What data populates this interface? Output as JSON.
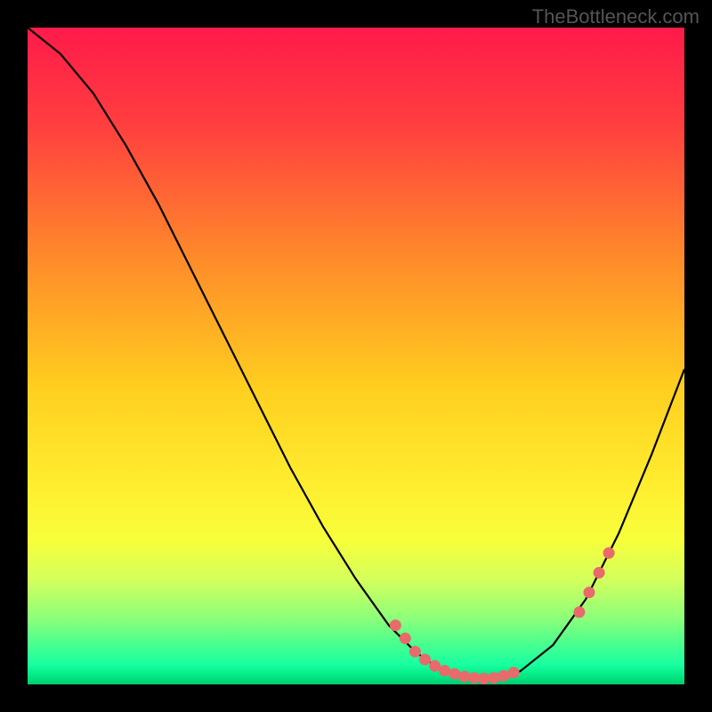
{
  "watermark": "TheBottleneck.com",
  "chart_data": {
    "type": "line",
    "title": "",
    "xlabel": "",
    "ylabel": "",
    "xlim": [
      0,
      100
    ],
    "ylim": [
      0,
      100
    ],
    "series": [
      {
        "name": "curve",
        "x": [
          0,
          5,
          10,
          15,
          20,
          25,
          30,
          35,
          40,
          45,
          50,
          55,
          57,
          59,
          61,
          63,
          65,
          67,
          69,
          71,
          73,
          75,
          80,
          85,
          90,
          95,
          100
        ],
        "y": [
          100,
          96,
          90,
          82,
          73,
          63,
          53,
          43,
          33,
          24,
          16,
          9,
          7,
          5,
          3.5,
          2.5,
          1.8,
          1.3,
          1,
          1,
          1.3,
          2,
          6,
          13,
          23,
          35,
          48
        ]
      }
    ],
    "markers": [
      {
        "x": 56,
        "y": 9
      },
      {
        "x": 57.5,
        "y": 7
      },
      {
        "x": 59,
        "y": 5
      },
      {
        "x": 60.5,
        "y": 3.8
      },
      {
        "x": 62,
        "y": 2.8
      },
      {
        "x": 63.5,
        "y": 2.1
      },
      {
        "x": 65,
        "y": 1.6
      },
      {
        "x": 66.5,
        "y": 1.2
      },
      {
        "x": 68,
        "y": 1.0
      },
      {
        "x": 69.5,
        "y": 0.9
      },
      {
        "x": 71,
        "y": 1.0
      },
      {
        "x": 72.5,
        "y": 1.3
      },
      {
        "x": 74,
        "y": 1.8
      },
      {
        "x": 84,
        "y": 11
      },
      {
        "x": 85.5,
        "y": 14
      },
      {
        "x": 87,
        "y": 17
      },
      {
        "x": 88.5,
        "y": 20
      }
    ],
    "colors": {
      "curve": "#000000",
      "markers": "#e86a6a"
    }
  }
}
